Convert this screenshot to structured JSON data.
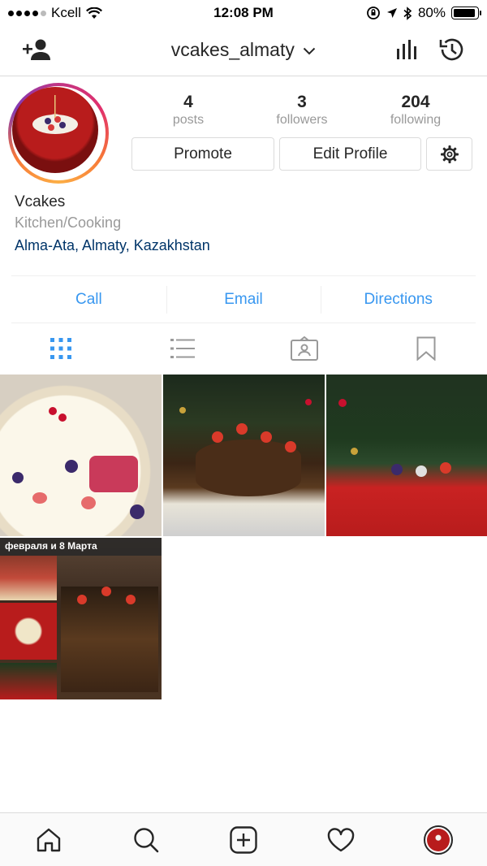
{
  "status_bar": {
    "carrier": "Kcell",
    "time": "12:08 PM",
    "battery": "80%",
    "battery_level": 0.8
  },
  "nav": {
    "username": "vcakes_almaty",
    "icons": [
      "add-person-icon",
      "chevron-down-icon",
      "insights-icon",
      "archive-icon"
    ]
  },
  "profile": {
    "posts_count": "4",
    "posts_label": "posts",
    "followers_count": "3",
    "followers_label": "followers",
    "following_count": "204",
    "following_label": "following",
    "promote_label": "Promote",
    "edit_profile_label": "Edit Profile",
    "name": "Vcakes",
    "category": "Kitchen/Cooking",
    "location": "Alma-Ata, Almaty, Kazakhstan"
  },
  "actions": {
    "call": "Call",
    "email": "Email",
    "directions": "Directions"
  },
  "tabs": [
    "grid-icon",
    "list-icon",
    "tagged-icon",
    "saved-icon"
  ],
  "posts": [
    {
      "caption": ""
    },
    {
      "caption": ""
    },
    {
      "caption": ""
    },
    {
      "caption": "февраля и 8 Марта"
    }
  ],
  "bottom_nav": [
    "home-icon",
    "search-icon",
    "new-post-icon",
    "activity-icon",
    "profile-avatar"
  ],
  "colors": {
    "link_blue": "#3897f0",
    "location_blue": "#003569",
    "border": "#dbdbdb",
    "muted": "#999999"
  }
}
